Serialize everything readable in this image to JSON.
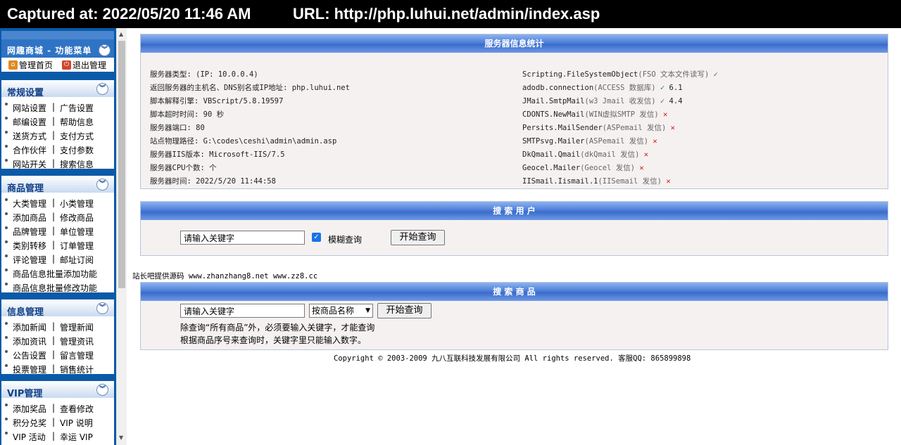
{
  "capture": {
    "captured_at": "Captured at: 2022/05/20 11:46 AM",
    "url": "URL: http://php.luhui.net/admin/index.asp"
  },
  "sidebar": {
    "brand": "网趣商城 - 功能菜单",
    "quick_links": [
      "管理首页",
      "退出管理"
    ],
    "panels": [
      {
        "title": "常规设置",
        "rows": [
          [
            "网站设置",
            "广告设置"
          ],
          [
            "邮编设置",
            "帮助信息"
          ],
          [
            "送货方式",
            "支付方式"
          ],
          [
            "合作伙伴",
            "支付参数"
          ],
          [
            "网站开关",
            "搜索信息"
          ]
        ]
      },
      {
        "title": "商品管理",
        "rows": [
          [
            "大类管理",
            "小类管理"
          ],
          [
            "添加商品",
            "修改商品"
          ],
          [
            "品牌管理",
            "单位管理"
          ],
          [
            "类别转移",
            "订单管理"
          ],
          [
            "评论管理",
            "邮址订阅"
          ],
          [
            "商品信息批量添加功能"
          ],
          [
            "商品信息批量修改功能"
          ]
        ]
      },
      {
        "title": "信息管理",
        "rows": [
          [
            "添加新闻",
            "管理新闻"
          ],
          [
            "添加资讯",
            "管理资讯"
          ],
          [
            "公告设置",
            "留言管理"
          ],
          [
            "投票管理",
            "销售统计"
          ]
        ]
      },
      {
        "title": "VIP管理",
        "rows": [
          [
            "添加奖品",
            "查看修改"
          ],
          [
            "积分兑奖",
            "VIP 说明"
          ],
          [
            "VIP 活动",
            "幸运 VIP"
          ]
        ]
      }
    ]
  },
  "server_info": {
    "title": "服务器信息统计",
    "left": [
      "服务器类型:  (IP: 10.0.0.4)",
      "返回服务器的主机名、DNS别名或IP地址: php.luhui.net",
      "脚本解释引擎: VBScript/5.8.19597",
      "脚本超时时间: 90 秒",
      "服务器端口: 80",
      "站点物理路径: G:\\codes\\ceshi\\admin\\admin.asp",
      "服务器IIS版本: Microsoft-IIS/7.5",
      "服务器CPU个数:  个",
      "服务器时间: 2022/5/20 11:44:58"
    ],
    "components": [
      {
        "name": "Scripting.FileSystemObject",
        "desc": "(FSO 文本文件读写)",
        "ok": true,
        "ver": ""
      },
      {
        "name": "adodb.connection",
        "desc": "(ACCESS 数据库)",
        "ok": true,
        "ver": "6.1"
      },
      {
        "name": "JMail.SmtpMail",
        "desc": "(w3 Jmail 收发信)",
        "ok": true,
        "ver": "4.4"
      },
      {
        "name": "CDONTS.NewMail",
        "desc": "(WIN虚拟SMTP 发信)",
        "ok": false,
        "ver": ""
      },
      {
        "name": "Persits.MailSender",
        "desc": "(ASPemail 发信)",
        "ok": false,
        "ver": ""
      },
      {
        "name": "SMTPsvg.Mailer",
        "desc": "(ASPemail 发信)",
        "ok": false,
        "ver": ""
      },
      {
        "name": "DkQmail.Qmail",
        "desc": "(dkQmail 发信)",
        "ok": false,
        "ver": ""
      },
      {
        "name": "Geocel.Mailer",
        "desc": "(Geocel 发信)",
        "ok": false,
        "ver": ""
      },
      {
        "name": "IISmail.Iismail.1",
        "desc": "(IISemail 发信)",
        "ok": false,
        "ver": ""
      }
    ]
  },
  "search_user": {
    "title": "搜 索 用 户",
    "input_value": "请输入关键字",
    "fuzzy_label": "模糊查询",
    "fuzzy_checked": true,
    "button": "开始查询"
  },
  "source_note": "站长吧提供源码 www.zhanzhang8.net www.zz8.cc",
  "search_goods": {
    "title": "搜 索 商 品",
    "input_value": "请输入关键字",
    "select_value": "按商品名称",
    "button": "开始查询",
    "note1": "除查询“所有商品”外，必须要输入关键字，才能查询",
    "note2": "根据商品序号来查询时，关键字里只能输入数字。"
  },
  "copyright": "Copyright © 2003-2009 九八互联科技发展有限公司 All rights reserved. 客服QQ: 865899898",
  "colors": {
    "sidebar_bg": "#0a5aa8",
    "header_blue": "#4d7fd9",
    "ok": "#2a8a2a",
    "fail": "#d11111"
  }
}
